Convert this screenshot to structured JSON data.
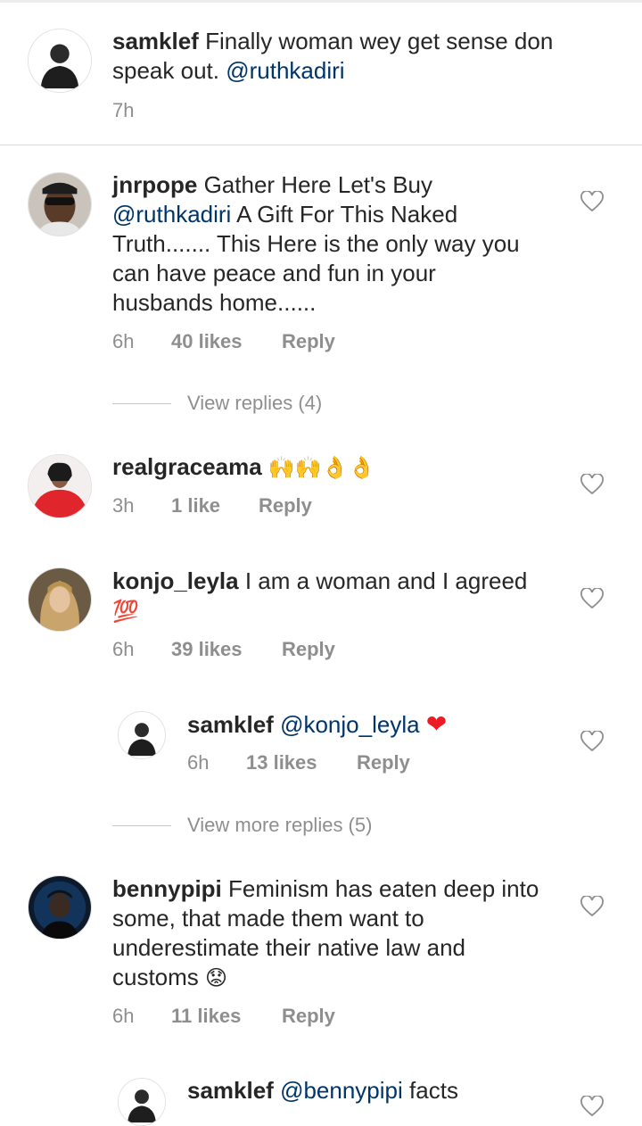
{
  "comments": [
    {
      "username": "samklef",
      "text": "Finally woman wey get sense don speak out.",
      "mention": "@ruthkadiri",
      "time": "7h"
    },
    {
      "username": "jnrpope",
      "text_before": "Gather Here Let's Buy",
      "mention": "@ruthkadiri",
      "text_after": "A Gift For This Naked Truth....... This Here is the only way you can have peace and fun in your husbands home......",
      "time": "6h",
      "likes": "40 likes",
      "reply": "Reply",
      "view_replies": "View replies (4)"
    },
    {
      "username": "realgraceama",
      "text": "🙌🙌👌👌",
      "time": "3h",
      "likes": "1 like",
      "reply": "Reply"
    },
    {
      "username": "konjo_leyla",
      "text": "I am a woman and I agreed",
      "emoji": "💯",
      "time": "6h",
      "likes": "39 likes",
      "reply": "Reply",
      "reply_item": {
        "username": "samklef",
        "mention": "@konjo_leyla",
        "emoji": "❤",
        "time": "6h",
        "likes": "13 likes",
        "reply": "Reply"
      },
      "view_more_replies": "View more replies (5)"
    },
    {
      "username": "bennypipi",
      "text": "Feminism has eaten deep into some, that made them want to underestimate their native law and customs",
      "emoji": "😟",
      "time": "6h",
      "likes": "11 likes",
      "reply": "Reply",
      "reply_item": {
        "username": "samklef",
        "mention": "@bennypipi",
        "text": "facts"
      }
    }
  ],
  "colors": {
    "text": "#262626",
    "mention": "#003569",
    "meta": "#8e8e8e",
    "separator": "#dbdbdb",
    "heart_emoji": "#ed1c24"
  },
  "icons": {
    "like": "heart-outline-icon"
  }
}
